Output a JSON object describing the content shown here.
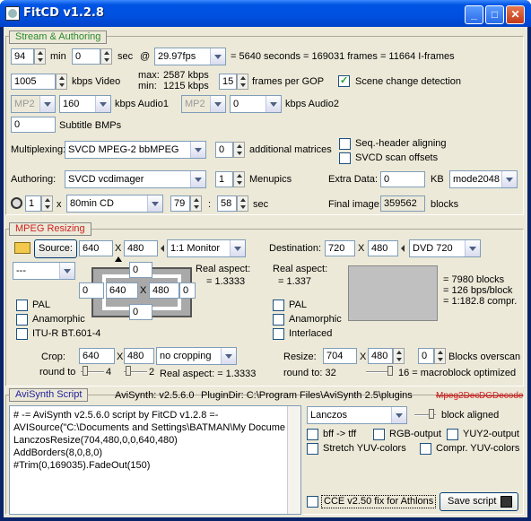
{
  "window": {
    "title": "FitCD v1.2.8"
  },
  "stream": {
    "header": "Stream & Authoring",
    "min_value": "94",
    "min_label": "min",
    "sec_value": "0",
    "sec_label": "sec",
    "at_label": "@",
    "fps": "29.97fps",
    "frames_info": "= 5640 seconds = 169031 frames = 11664 I-frames",
    "video_kbps": "1005",
    "video_kbps_label": "kbps Video",
    "max_label": "max:",
    "max_value": "2587 kbps",
    "min2_label": "min:",
    "min2_value": "1215 kbps",
    "gop_value": "15",
    "gop_label": "frames per GOP",
    "scene_change_label": "Scene change detection",
    "audio1_codec": "MP2",
    "audio1_kbps": "160",
    "audio1_label": "kbps Audio1",
    "audio2_codec": "MP2",
    "audio2_kbps": "0",
    "audio2_label": "kbps Audio2",
    "subtitle_value": "0",
    "subtitle_label": "Subtitle BMPs",
    "multiplexing_label": "Multiplexing:",
    "multiplexing_value": "SVCD MPEG-2 bbMPEG",
    "matrices_value": "0",
    "matrices_label": "additional matrices",
    "seq_header_label": "Seq.-header aligning",
    "svcd_scan_label": "SVCD scan offsets",
    "authoring_label": "Authoring:",
    "authoring_value": "SVCD vcdimager",
    "menupics_value": "1",
    "menupics_label": "Menupics",
    "extra_data_label": "Extra Data:",
    "extra_data_value": "0",
    "extra_data_unit": "KB",
    "mode_value": "mode2048",
    "cd_count": "1",
    "x_label": "x",
    "cd_type": "80min CD",
    "cd_min": "79",
    "colon": ":",
    "cd_sec": "58",
    "cd_sec_label": "sec",
    "final_image_label": "Final image:",
    "final_image_value": "359562",
    "final_image_unit": "blocks"
  },
  "resize": {
    "header": "MPEG Resizing",
    "source_label": "Source:",
    "src_w": "640",
    "x": "X",
    "src_h": "480",
    "monitor": "1:1 Monitor",
    "destination_label": "Destination:",
    "dst_w": "720",
    "dst_h": "480",
    "dst_format": "DVD 720",
    "preset": "---",
    "top_border": "0",
    "left_border": "0",
    "inner_w": "640",
    "inner_h": "480",
    "right_border": "0",
    "bottom_border": "0",
    "real_aspect_label": "Real aspect:",
    "real_aspect_value": "= 1.3333",
    "dst_real_aspect_label": "Real aspect:",
    "dst_real_aspect_value": "= 1.337",
    "blocks_info": "= 7980 blocks",
    "bps_info": "= 126 bps/block",
    "compr_info": "= 1:182.8 compr.",
    "pal_label": "PAL",
    "anamorphic_label": "Anamorphic",
    "itu_label": "ITU-R BT.601-4",
    "dst_pal_label": "PAL",
    "dst_anamorphic_label": "Anamorphic",
    "interlaced_label": "Interlaced",
    "crop_label": "Crop:",
    "crop_w": "640",
    "crop_h": "480",
    "crop_mode": "no cropping",
    "round_to_label": "round to",
    "round1": "4",
    "round2": "2",
    "crop_real_aspect": "Real aspect: = 1.3333",
    "resize_label": "Resize:",
    "resize_w": "704",
    "resize_h": "480",
    "overscan_value": "0",
    "overscan_label": "Blocks overscan",
    "resize_round_label": "round to: 32",
    "macroblock_label": "16  = macroblock optimized"
  },
  "avisynth": {
    "header": "AviSynth Script",
    "version": "AviSynth:  v2.5.6.0",
    "plugindir": "PluginDir:  C:\\Program Files\\AviSynth 2.5\\plugins",
    "mpeg2dec": "Mpeg2Dec",
    "dgdecode": "DGDecode",
    "script_lines": [
      "# -= AviSynth v2.5.6.0 script by FitCD v1.2.8 =-",
      "AVISource(\"C:\\Documents and Settings\\BATMAN\\My Docume",
      "LanczosResize(704,480,0,0,640,480)",
      "AddBorders(8,0,8,0)",
      "#Trim(0,169035).FadeOut(150)"
    ],
    "resizer": "Lanczos",
    "block_aligned_label": "block aligned",
    "bff_label": "bff -> tff",
    "rgb_label": "RGB-output",
    "yuy2_label": "YUY2-output",
    "stretch_label": "Stretch YUV-colors",
    "compr_label": "Compr. YUV-colors",
    "cce_label": "CCE v2.50 fix for Athlons",
    "save_label": "Save script"
  }
}
